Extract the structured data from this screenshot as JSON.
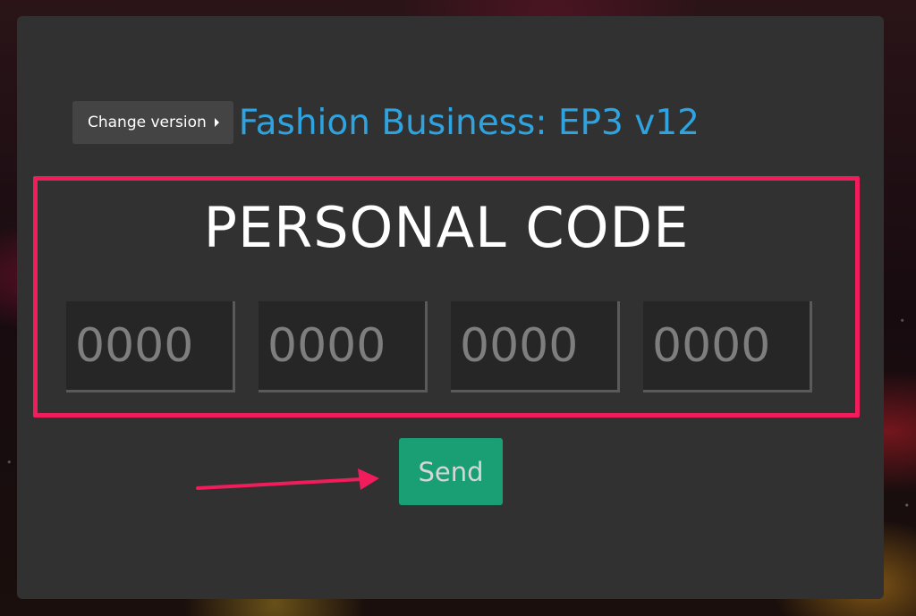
{
  "header": {
    "change_version_label": "Change version",
    "title": "Fashion Business: EP3 v12"
  },
  "code_section": {
    "heading": "PERSONAL CODE",
    "fields": [
      {
        "placeholder": "0000"
      },
      {
        "placeholder": "0000"
      },
      {
        "placeholder": "0000"
      },
      {
        "placeholder": "0000"
      }
    ]
  },
  "send_button_label": "Send",
  "colors": {
    "panel": "#313131",
    "title": "#2ea3df",
    "highlight": "#f01c5c",
    "send_button": "#1a9f75"
  },
  "icons": {
    "change_version_caret": "caret-right-icon",
    "annotation": "arrow-right-icon"
  }
}
